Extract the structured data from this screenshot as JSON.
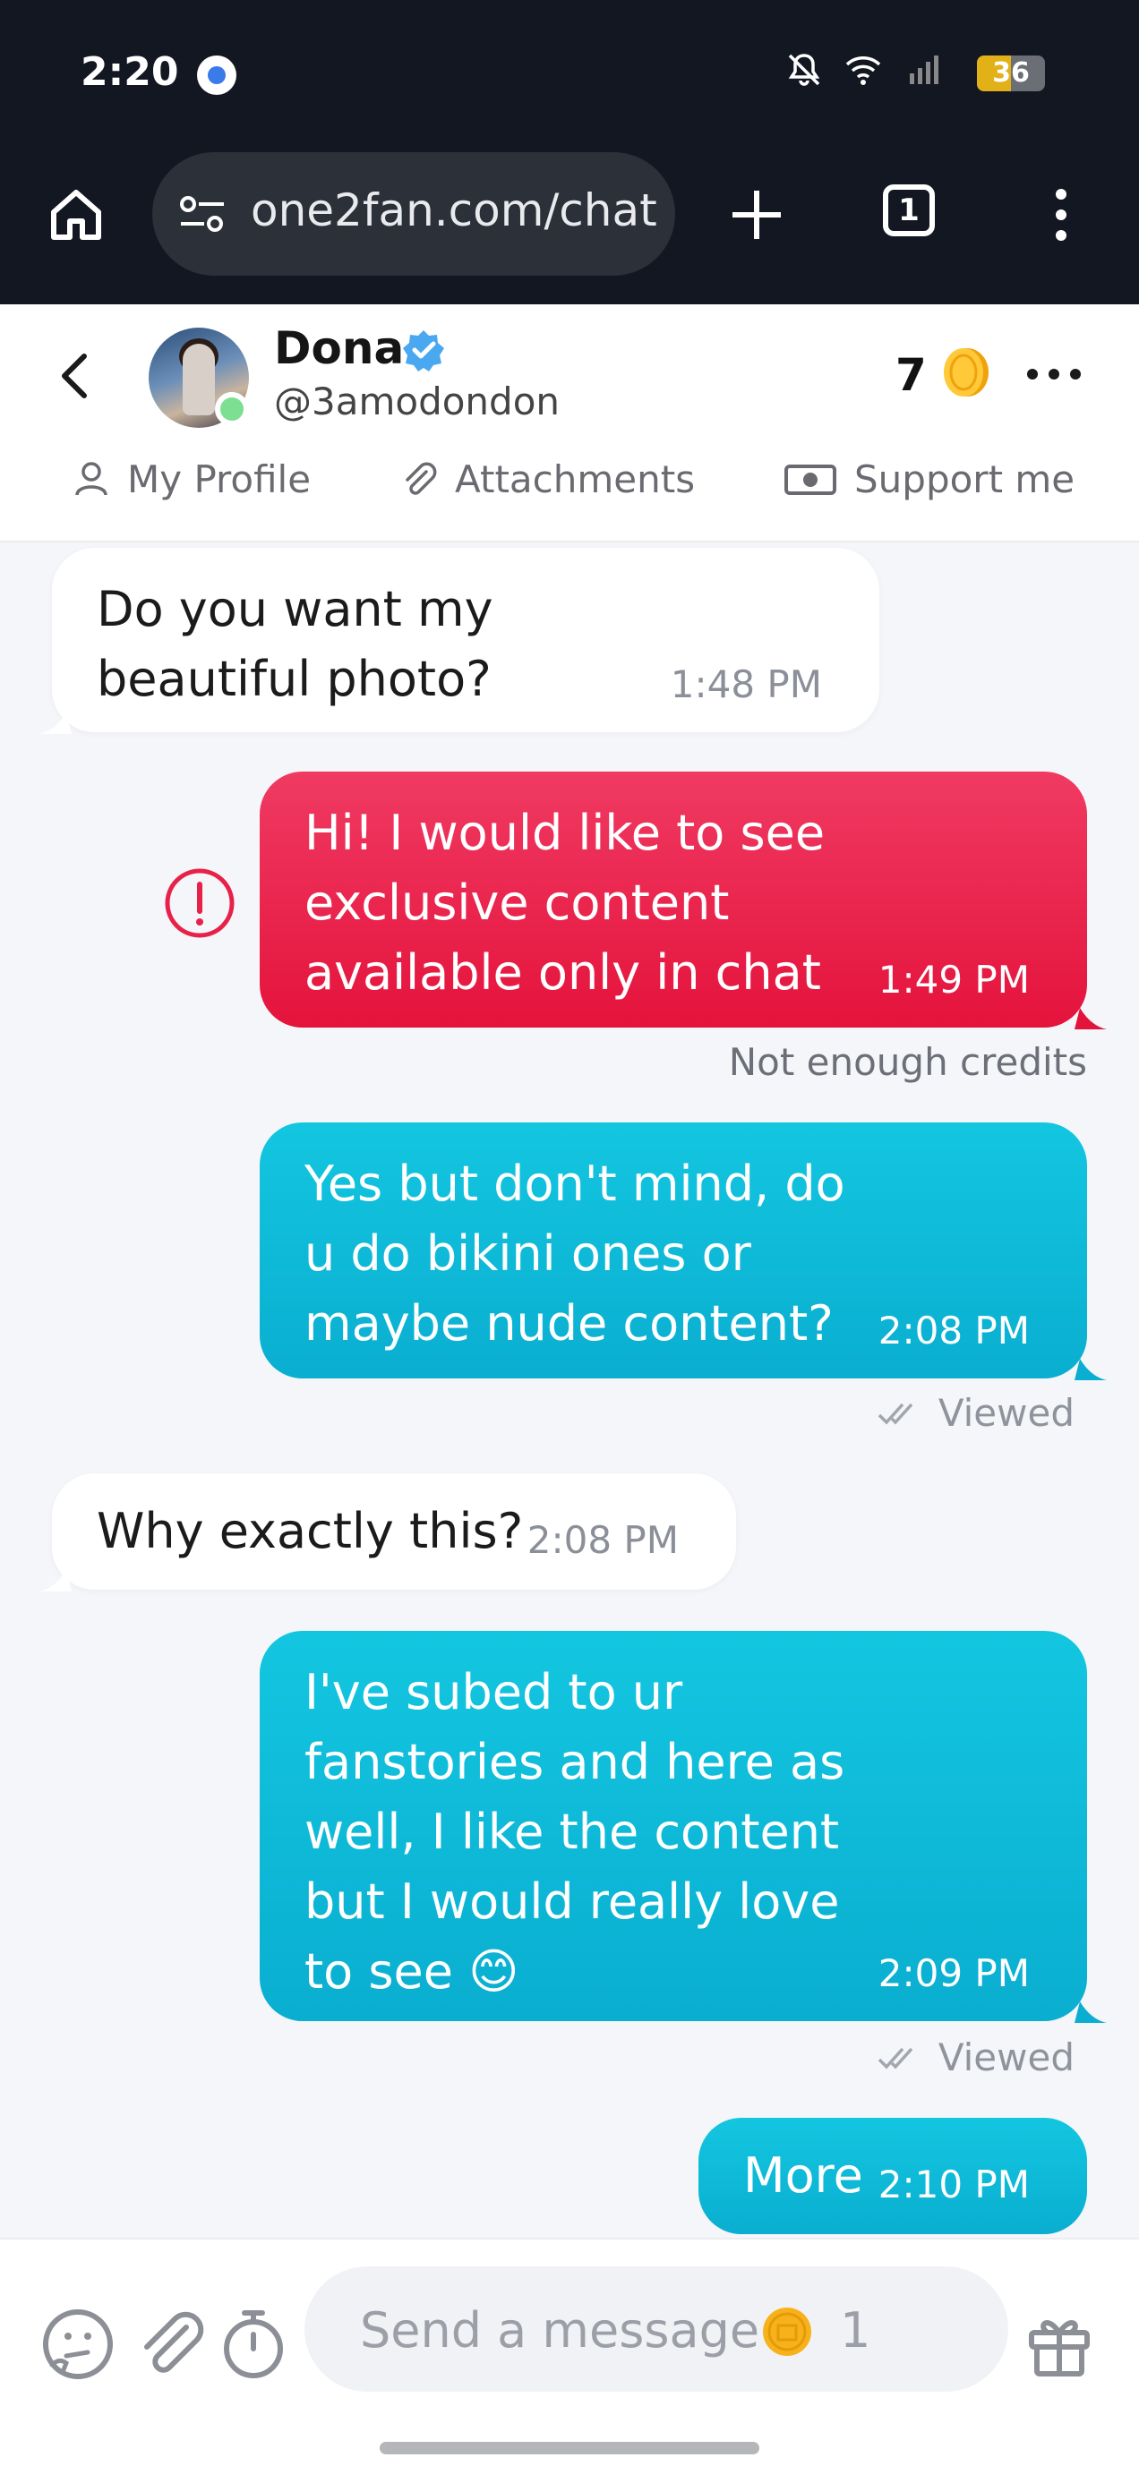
{
  "status_bar": {
    "time": "2:20",
    "battery": "36"
  },
  "browser": {
    "url": "one2fan.com/chat",
    "tab_count": "1"
  },
  "header": {
    "name": "Dona",
    "handle": "@3amodondon",
    "credits": "7",
    "tabs": [
      {
        "label": "My Profile",
        "icon": "user-icon"
      },
      {
        "label": "Attachments",
        "icon": "paperclip-icon"
      },
      {
        "label": "Support me",
        "icon": "money-icon"
      }
    ]
  },
  "messages": [
    {
      "direction": "incoming",
      "lines": [
        "Do you want my",
        "beautiful photo?"
      ],
      "time": "1:48 PM"
    },
    {
      "direction": "outgoing",
      "status": "failed",
      "lines": [
        "Hi! I would like to see",
        "exclusive content",
        "available only in chat"
      ],
      "time": "1:49 PM",
      "note": "Not enough credits"
    },
    {
      "direction": "outgoing",
      "lines": [
        "Yes but don't mind, do",
        "u do bikini ones or",
        "maybe nude content?"
      ],
      "time": "2:08 PM",
      "receipt": "Viewed"
    },
    {
      "direction": "incoming",
      "lines": [
        "Why exactly this?"
      ],
      "time": "2:08 PM"
    },
    {
      "direction": "outgoing",
      "lines": [
        "I've subed to ur",
        "fanstories and here as",
        "well, I like the content",
        "but I would really love",
        "to see 😊"
      ],
      "time": "2:09 PM",
      "receipt": "Viewed"
    },
    {
      "direction": "outgoing",
      "lines": [
        "More"
      ],
      "time": "2:10 PM"
    }
  ],
  "composer": {
    "placeholder": "Send a message",
    "cost": "1"
  },
  "colors": {
    "accent_teal": "#0fbddb",
    "error_red": "#e8214a",
    "coin": "#f7b21b",
    "online": "#7ddf92",
    "verified": "#4aa8f0"
  }
}
